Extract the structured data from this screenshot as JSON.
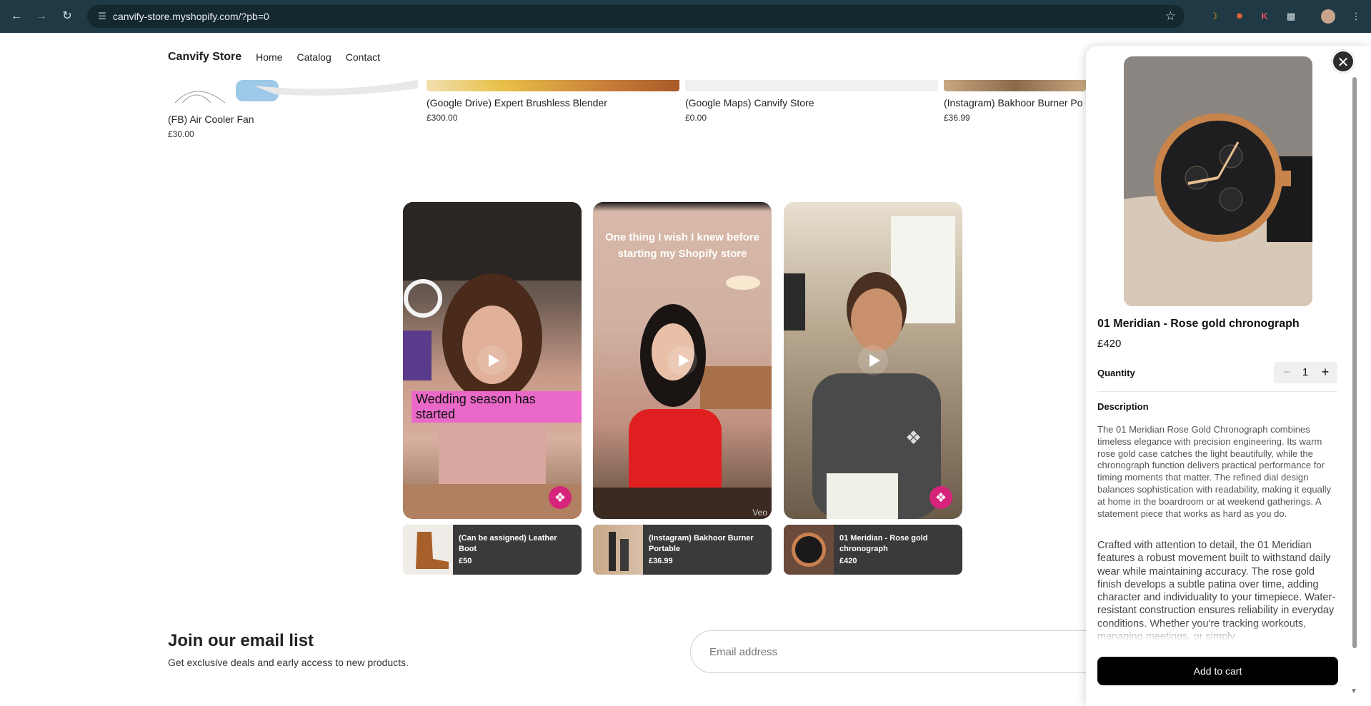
{
  "browser": {
    "url": "canvify-store.myshopify.com/?pb=0"
  },
  "store": {
    "brand": "Canvify Store",
    "nav": [
      "Home",
      "Catalog",
      "Contact"
    ]
  },
  "products": [
    {
      "name": "(FB) Air Cooler Fan",
      "price": "£30.00"
    },
    {
      "name": "(Google Drive) Expert Brushless Blender",
      "price": "£300.00"
    },
    {
      "name": "(Google Maps) Canvify Store",
      "price": "£0.00"
    },
    {
      "name": "(Instagram) Bakhoor Burner Po",
      "price": "£36.99"
    }
  ],
  "videos": [
    {
      "overlay_text": "Wedding season has started",
      "product_name": "(Can be assigned) Leather Boot",
      "product_price": "£50"
    },
    {
      "overlay_text": "One thing I wish I knew before starting my Shopify store",
      "watermark": "Veo",
      "product_name": "(Instagram) Bakhoor Burner Portable",
      "product_price": "£36.99"
    },
    {
      "overlay_text": "",
      "product_name": "01 Meridian - Rose gold chronograph",
      "product_price": "£420"
    }
  ],
  "email": {
    "title": "Join our email list",
    "subtitle": "Get exclusive deals and early access to new products.",
    "placeholder": "Email address"
  },
  "drawer": {
    "title": "01 Meridian - Rose gold chronograph",
    "price": "£420",
    "quantity_label": "Quantity",
    "quantity": "1",
    "description_label": "Description",
    "description_p1": "The 01 Meridian Rose Gold Chronograph combines timeless elegance with precision engineering. Its warm rose gold case catches the light beautifully, while the chronograph function delivers practical performance for timing moments that matter. The refined dial design balances sophistication with readability, making it equally at home in the boardroom or at weekend gatherings. A statement piece that works as hard as you do.",
    "description_p2": "Crafted with attention to detail, the 01 Meridian features a robust movement built to withstand daily wear while maintaining accuracy. The rose gold finish develops a subtle patina over time, adding character and individuality to your timepiece. Water-resistant construction ensures reliability in everyday conditions. Whether you're tracking workouts, managing meetings, or simply",
    "add_to_cart": "Add to cart"
  },
  "colors": {
    "chrome": "#1f3a44",
    "accent_pink": "#d6247a",
    "button_black": "#000000"
  }
}
